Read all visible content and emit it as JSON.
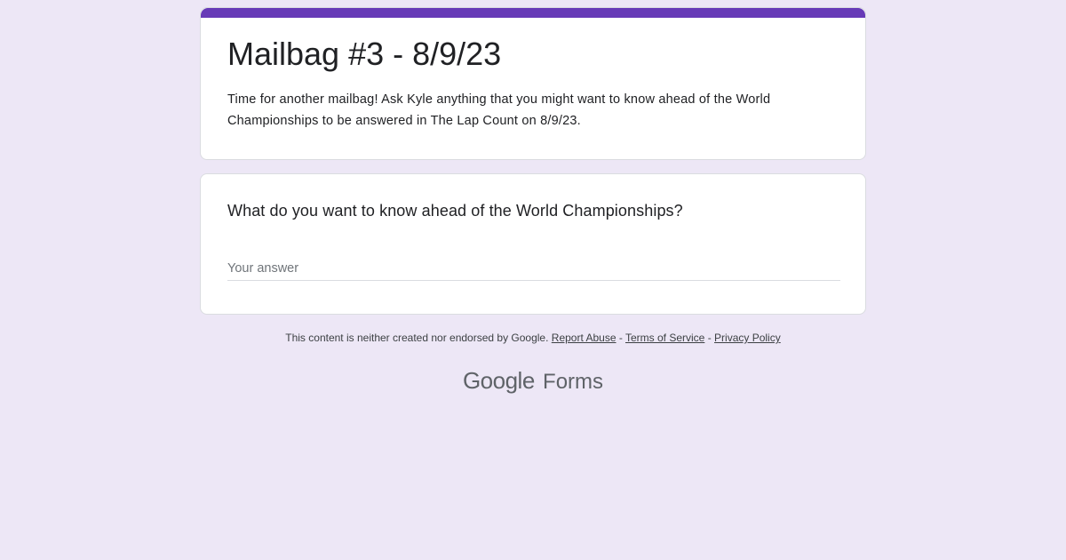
{
  "theme": {
    "accent_color": "#673ab7",
    "background_color": "#ede7f6"
  },
  "form": {
    "title": "Mailbag #3 - 8/9/23",
    "description": "Time for another mailbag! Ask Kyle anything that you might want to know ahead of the World Championships to be answered in The Lap Count on 8/9/23."
  },
  "question": {
    "title": "What do you want to know ahead of the World Championships?",
    "placeholder": "Your answer"
  },
  "footer": {
    "disclaimer": "This content is neither created nor endorsed by Google.",
    "separator": "-",
    "report_abuse": "Report Abuse",
    "terms": "Terms of Service",
    "privacy": "Privacy Policy"
  },
  "branding": {
    "google": "Google",
    "forms": "Forms"
  }
}
